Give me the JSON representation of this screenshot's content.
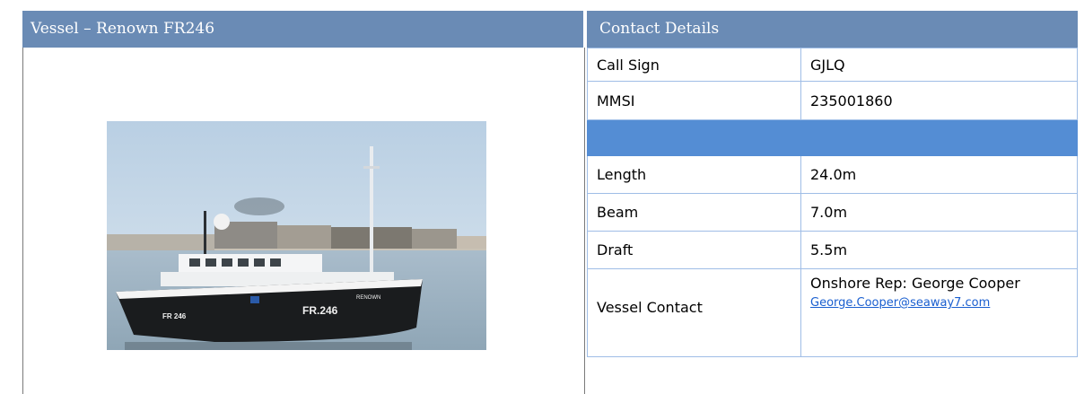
{
  "vessel_panel": {
    "header": "Vessel – Renown FR246",
    "photo": {
      "hull_number": "FR.246",
      "hull_name": "RENOWN",
      "bow_number": "FR 246"
    }
  },
  "contact_panel": {
    "header": "Contact Details",
    "rows": [
      {
        "label": "Call Sign",
        "value": "GJLQ"
      },
      {
        "label": "MMSI",
        "value": "235001860"
      },
      {
        "label": "Length",
        "value": "24.0m"
      },
      {
        "label": "Beam",
        "value": "7.0m"
      },
      {
        "label": "Draft",
        "value": "5.5m"
      }
    ],
    "vessel_contact": {
      "label": "Vessel Contact",
      "prefix": "Onshore Rep: ",
      "name": "George Cooper",
      "email": "George.Cooper@seaway7.com"
    }
  },
  "colors": {
    "header_bg": "#6a8bb5",
    "separator_bg": "#548dd4",
    "link": "#1a5fd0"
  }
}
